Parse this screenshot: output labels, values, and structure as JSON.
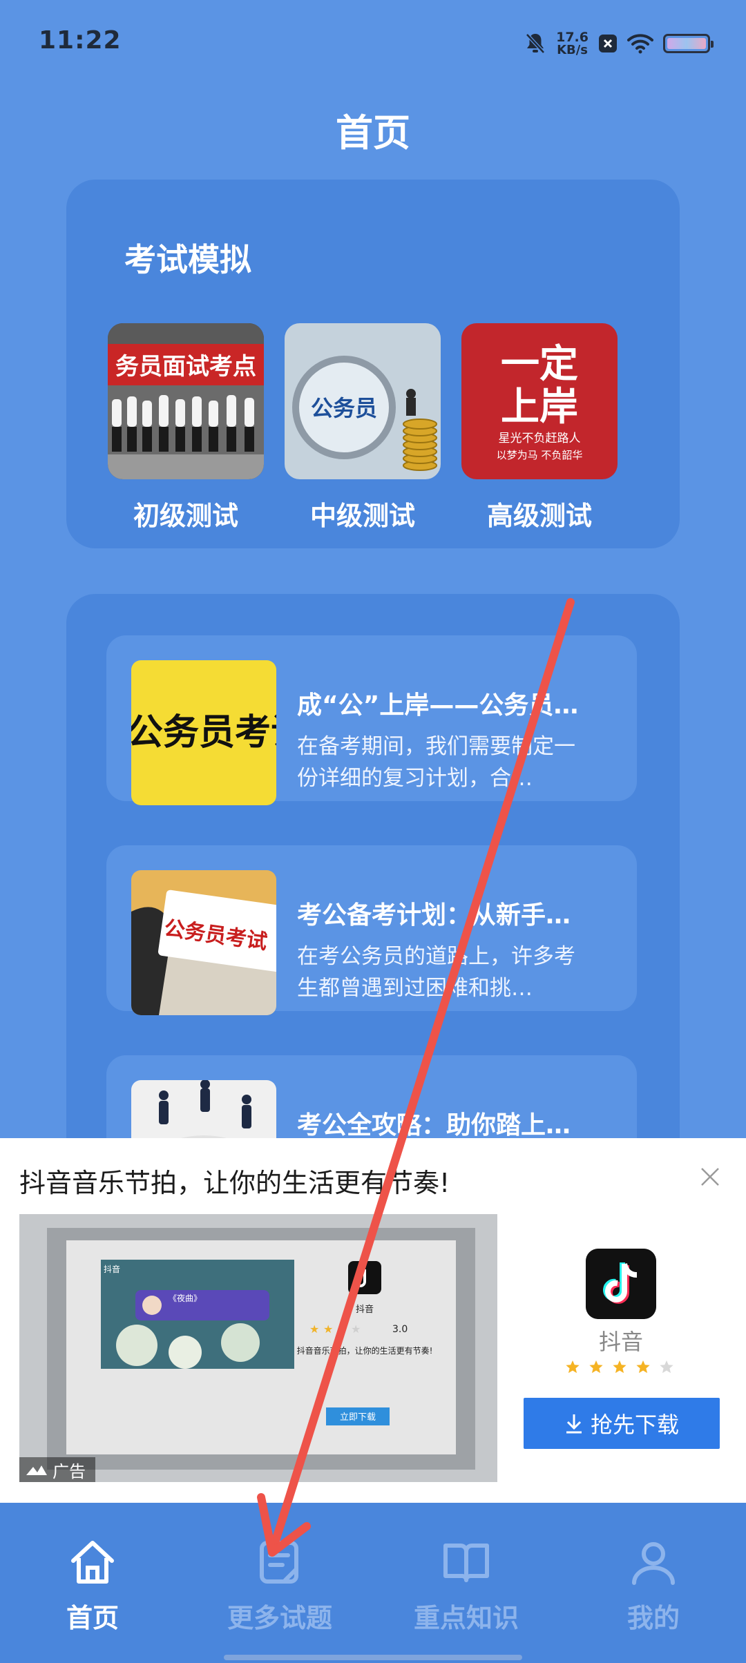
{
  "status_bar": {
    "time": "11:22",
    "net_speed_value": "17.6",
    "net_speed_unit": "KB/s"
  },
  "page": {
    "title": "首页"
  },
  "exam_section": {
    "title": "考试模拟",
    "items": [
      {
        "label": "初级测试",
        "image_text": "务员面试考点"
      },
      {
        "label": "中级测试",
        "image_text": "公务员"
      },
      {
        "label": "高级测试",
        "image_text_main_1": "一定",
        "image_text_main_2": "上岸",
        "image_text_sub_1": "星光不负赶路人",
        "image_text_sub_2": "以梦为马  不负韶华"
      }
    ]
  },
  "articles": [
    {
      "title": "成“公”上岸——公务员…",
      "desc": "在备考期间，我们需要制定一份详细的复习计划，合…",
      "image_text": "公务员考试"
    },
    {
      "title": "考公备考计划：从新手…",
      "desc": "在考公务员的道路上，许多考生都曾遇到过困难和挑…",
      "image_text": "公务员考试"
    },
    {
      "title": "考公全攻略：助你踏上…",
      "desc": "",
      "image_text": ""
    }
  ],
  "ad": {
    "headline": "抖音音乐节拍，让你的生活更有节奏!",
    "label": "广告",
    "app_name": "抖音",
    "rating": 4,
    "rating_max": 5,
    "download_label": "抢先下载",
    "media": {
      "brand": "抖音",
      "song_title": "《夜曲》",
      "score": "3.0",
      "tagline": "抖音音乐节拍，让你的生活更有节奏!",
      "button": "立即下载"
    }
  },
  "bottom_nav": [
    {
      "label": "首页",
      "active": true
    },
    {
      "label": "更多试题",
      "active": false
    },
    {
      "label": "重点知识",
      "active": false
    },
    {
      "label": "我的",
      "active": false
    }
  ],
  "colors": {
    "background": "#5b94e4",
    "card": "#4a86dc",
    "nav_inactive": "#8db4ec",
    "download_button": "#2f7be8",
    "annotation_arrow": "#ee5349"
  }
}
